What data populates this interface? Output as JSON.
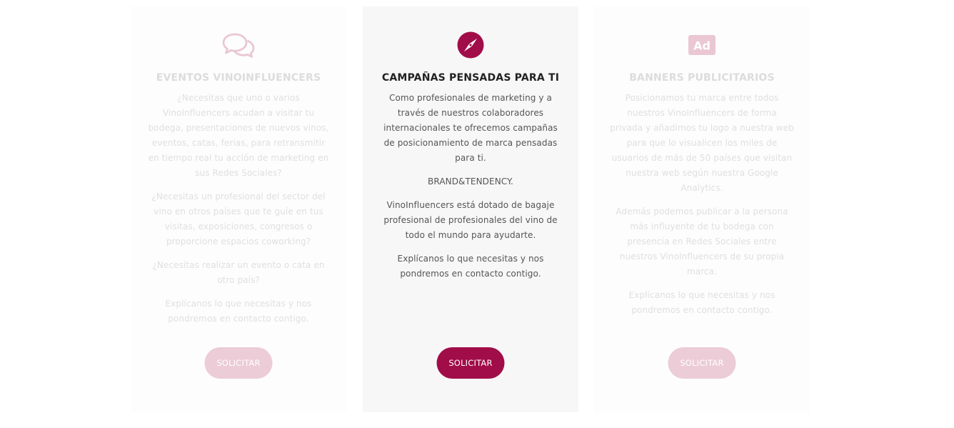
{
  "colors": {
    "accent": "#a10d49",
    "accent_faded": "#ecccd7",
    "icon_faded": "#eac7d3"
  },
  "cards": [
    {
      "icon": "chat-bubbles-icon",
      "title": "EVENTOS VINOINFLUENCERS",
      "paragraphs": [
        "¿Necesitas que uno o varios VinoInfluencers acudan a visitar tu bodega, presentaciones de nuevos vinos, eventos, catas, ferias, para retransmitir en tiempo real tu acción de marketing en sus Redes Sociales?",
        "¿Necesitas un profesional del sector del vino en otros países que te guíe en tus visitas, exposiciones, congresos o proporcione espacios coworking?",
        "¿Necesitas realizar un evento o cata en otro país?",
        "Explícanos lo que necesitas y nos pondremos en contacto contigo."
      ],
      "button": "SOLICITAR"
    },
    {
      "icon": "compass-icon",
      "title": "CAMPAÑAS PENSADAS PARA TI",
      "paragraphs": [
        "Como profesionales de marketing y a través de nuestros colaboradores internacionales te ofrecemos campañas de posicionamiento de marca pensadas para ti.",
        "BRAND&TENDENCY.",
        "VinoInfluencers está dotado de bagaje profesional de profesionales del vino de todo el mundo para ayudarte.",
        "Explícanos lo que necesitas y nos pondremos en contacto contigo."
      ],
      "button": "SOLICITAR"
    },
    {
      "icon": "ad-icon",
      "icon_text": "Ad",
      "title": "BANNERS PUBLICITARIOS",
      "paragraphs": [
        "Posicionamos tu marca entre todos nuestros VinoInfluencers de forma privada y añadimos tu logo a nuestra web para que lo visualicen los miles de usuarios de más de 50 países que visitan nuestra web según nuestra Google Analytics.",
        "Además podemos publicar a la persona más influyente de tu bodega con presencia en Redes Sociales entre nuestros VinoInfluencers de su propia marca.",
        "Explícanos lo que necesitas y nos pondremos en contacto contigo."
      ],
      "button": "SOLICITAR"
    }
  ]
}
